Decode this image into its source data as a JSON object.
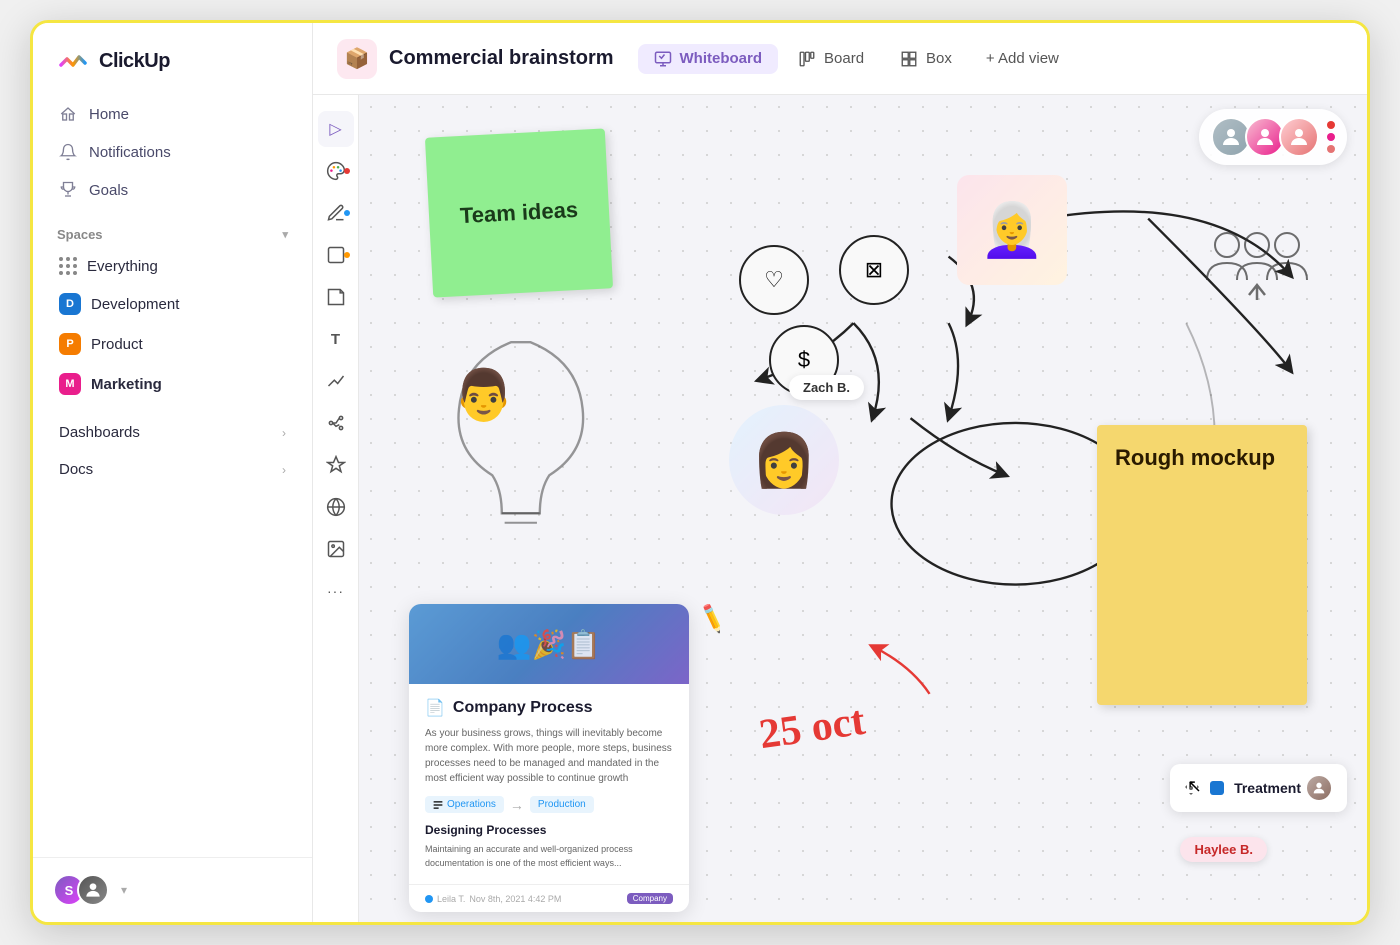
{
  "app": {
    "name": "ClickUp"
  },
  "sidebar": {
    "nav": [
      {
        "id": "home",
        "label": "Home",
        "icon": "home-icon"
      },
      {
        "id": "notifications",
        "label": "Notifications",
        "icon": "bell-icon"
      },
      {
        "id": "goals",
        "label": "Goals",
        "icon": "trophy-icon"
      }
    ],
    "spaces_label": "Spaces",
    "spaces": [
      {
        "id": "everything",
        "label": "Everything",
        "color": null,
        "letter": null
      },
      {
        "id": "development",
        "label": "Development",
        "color": "#1976d2",
        "letter": "D"
      },
      {
        "id": "product",
        "label": "Product",
        "color": "#f57c00",
        "letter": "P"
      },
      {
        "id": "marketing",
        "label": "Marketing",
        "color": "#e91e8c",
        "letter": "M"
      }
    ],
    "bottom": [
      {
        "id": "dashboards",
        "label": "Dashboards",
        "has_arrow": true
      },
      {
        "id": "docs",
        "label": "Docs",
        "has_arrow": true
      }
    ],
    "footer": {
      "avatar1_letter": "S",
      "avatar2_letter": ""
    }
  },
  "topbar": {
    "title": "Commercial brainstorm",
    "icon": "📦",
    "tabs": [
      {
        "id": "whiteboard",
        "label": "Whiteboard",
        "active": true
      },
      {
        "id": "board",
        "label": "Board",
        "active": false
      },
      {
        "id": "box",
        "label": "Box",
        "active": false
      }
    ],
    "add_view": "+ Add view"
  },
  "toolbar": {
    "tools": [
      {
        "id": "select",
        "icon": "▷"
      },
      {
        "id": "palette",
        "icon": "🎨"
      },
      {
        "id": "pen",
        "icon": "✏"
      },
      {
        "id": "shape",
        "icon": "□"
      },
      {
        "id": "sticky",
        "icon": "◱"
      },
      {
        "id": "text",
        "icon": "T"
      },
      {
        "id": "connector",
        "icon": "⟋"
      },
      {
        "id": "more1",
        "icon": "⚙"
      },
      {
        "id": "globe",
        "icon": "🌐"
      },
      {
        "id": "image",
        "icon": "🖼"
      },
      {
        "id": "ellipsis",
        "icon": "···"
      }
    ]
  },
  "canvas": {
    "sticky_green": {
      "text": "Team ideas"
    },
    "sticky_yellow": {
      "text": "Rough mockup"
    },
    "document": {
      "title": "Company Process",
      "body": "As your business grows, things will inevitably become more complex. With more people, more steps, business processes need to be managed and mandated in the most efficient way possible to continue growth",
      "workflow_from": "Operations",
      "workflow_to": "Production",
      "subtitle": "Designing Processes",
      "subtext": "Maintaining an accurate and well-organized process documentation is one of the most efficient ways...",
      "author": "Leila T.",
      "date": "Nov 8th, 2021 4:42 PM",
      "badge": "Company"
    },
    "annotation_date": "25 oct",
    "name_tags": [
      {
        "id": "zach",
        "label": "Zach B."
      },
      {
        "id": "haylee",
        "label": "Haylee B.",
        "style": "pink"
      }
    ],
    "treatment": {
      "label": "Treatment"
    },
    "avatars": [
      {
        "id": "av1",
        "color": "#b0b0b0"
      },
      {
        "id": "av2",
        "color": "#e91e8c"
      },
      {
        "id": "av3",
        "color": "#e57373"
      }
    ]
  }
}
